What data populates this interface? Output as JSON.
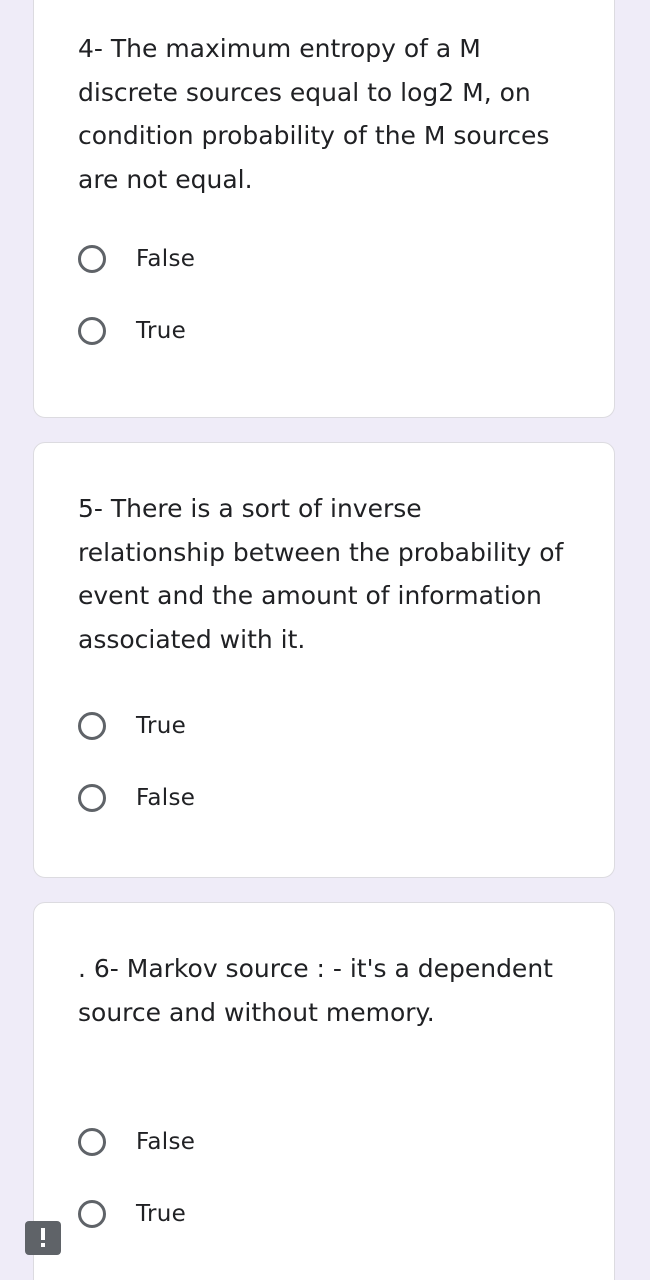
{
  "questions": [
    {
      "text": "4- The maximum entropy of a M discrete sources equal to log2 M, on condition probability of the M sources are not equal.",
      "options": [
        "False",
        "True"
      ]
    },
    {
      "text": "5- There is a sort of inverse relationship between the probability of event and the amount of information associated with it.",
      "options": [
        "True",
        "False"
      ]
    },
    {
      "text": ". 6- Markov source : - it's a dependent source and without memory.",
      "options": [
        "False",
        "True"
      ]
    }
  ],
  "icons": {
    "report": "exclamation-icon",
    "radio": "radio-unchecked-icon"
  },
  "colors": {
    "background": "#efecf8",
    "card": "#ffffff",
    "radio_border": "#5f6368",
    "text": "#202124"
  }
}
